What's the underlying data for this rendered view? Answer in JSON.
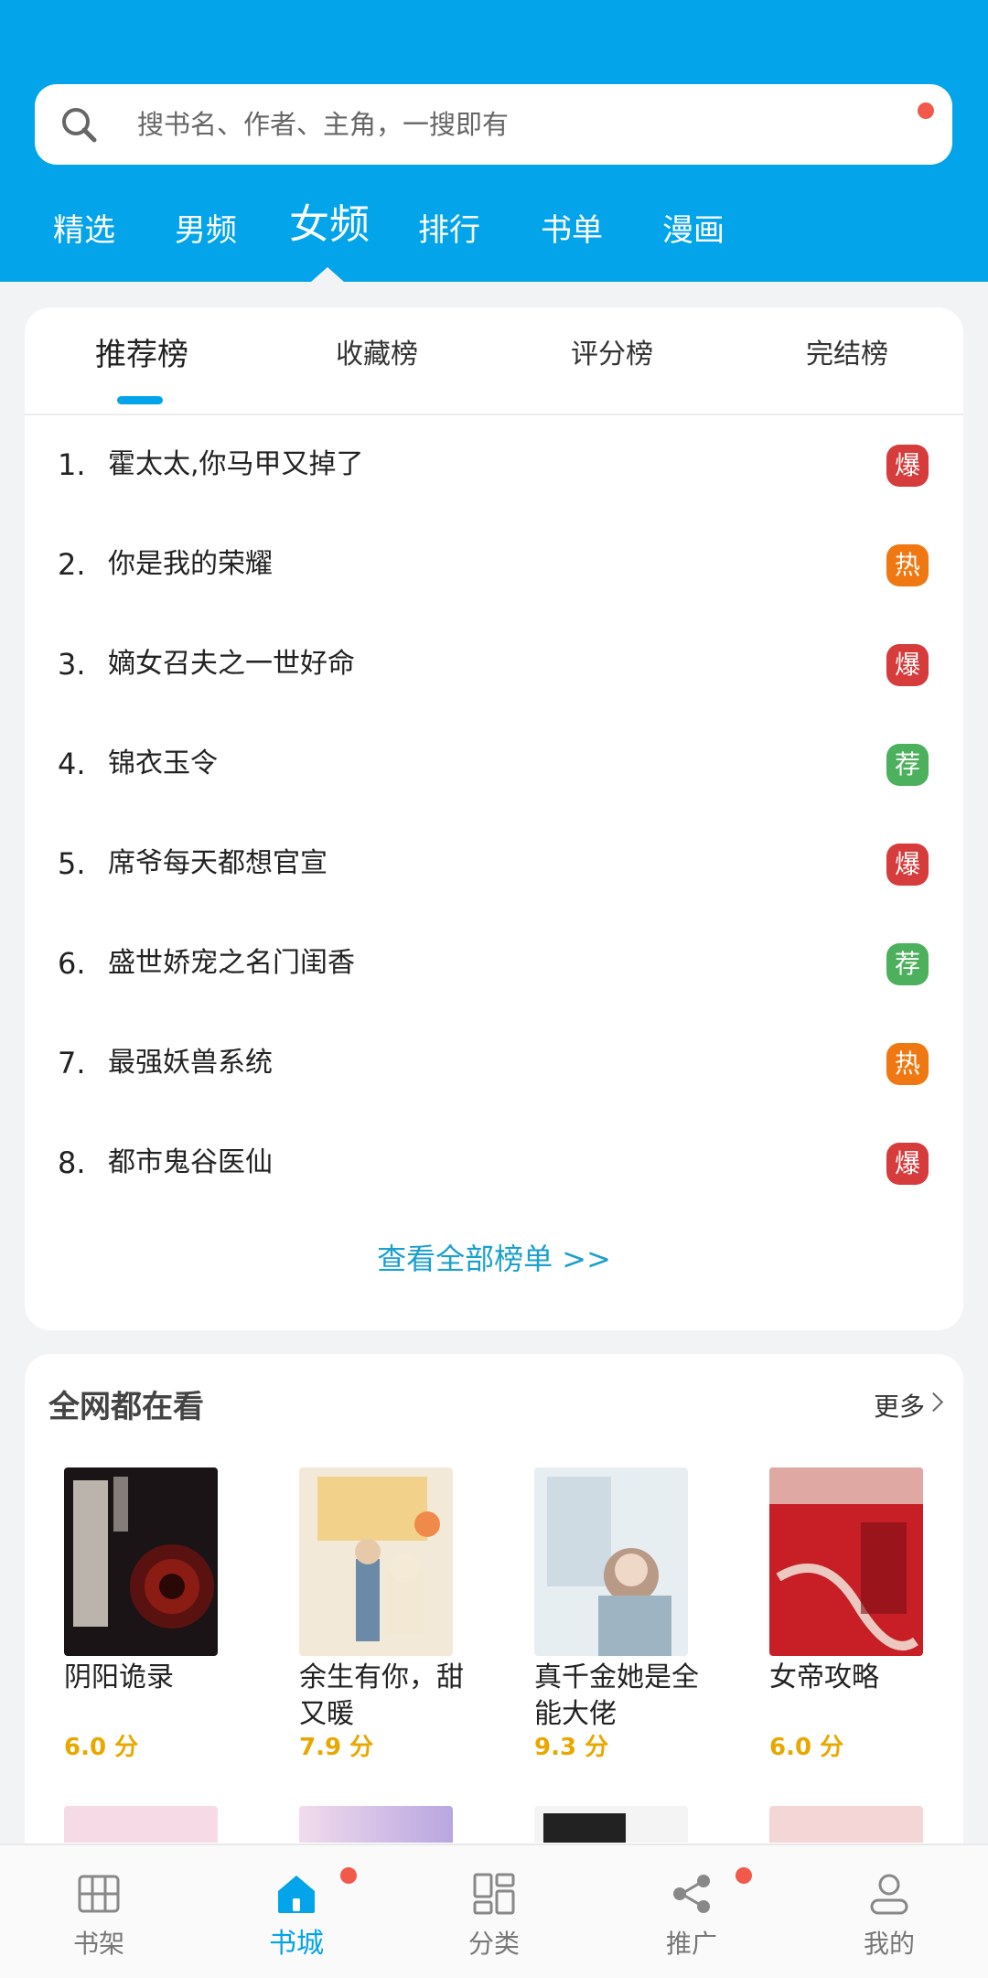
{
  "search": {
    "placeholder": "搜书名、作者、主角，一搜即有"
  },
  "channel_tabs": [
    "精选",
    "男频",
    "女频",
    "排行",
    "书单",
    "漫画"
  ],
  "active_channel": "女频",
  "rank": {
    "tabs": [
      "推荐榜",
      "收藏榜",
      "评分榜",
      "完结榜"
    ],
    "active_tab": "推荐榜",
    "items": [
      {
        "num": "1.",
        "title": "霍太太,你马甲又掉了",
        "badge": "爆",
        "badge_color": "#d63c3c"
      },
      {
        "num": "2.",
        "title": "你是我的荣耀",
        "badge": "热",
        "badge_color": "#f07812"
      },
      {
        "num": "3.",
        "title": "嫡女召夫之一世好命",
        "badge": "爆",
        "badge_color": "#d63c3c"
      },
      {
        "num": "4.",
        "title": "锦衣玉令",
        "badge": "荐",
        "badge_color": "#4cb05c"
      },
      {
        "num": "5.",
        "title": "席爷每天都想官宣",
        "badge": "爆",
        "badge_color": "#d63c3c"
      },
      {
        "num": "6.",
        "title": "盛世娇宠之名门闺香",
        "badge": "荐",
        "badge_color": "#4cb05c"
      },
      {
        "num": "7.",
        "title": "最强妖兽系统",
        "badge": "热",
        "badge_color": "#f07812"
      },
      {
        "num": "8.",
        "title": "都市鬼谷医仙",
        "badge": "爆",
        "badge_color": "#d63c3c"
      }
    ],
    "view_all": "查看全部榜单 >>"
  },
  "popular": {
    "title": "全网都在看",
    "more": "更多",
    "books": [
      {
        "title": "阴阳诡录",
        "score": "6.0 分"
      },
      {
        "title": "余生有你，甜又暖",
        "score": "7.9 分"
      },
      {
        "title": "真千金她是全能大佬",
        "score": "9.3 分"
      },
      {
        "title": "女帝攻略",
        "score": "6.0 分"
      }
    ]
  },
  "nav": [
    {
      "label": "书架",
      "icon": "bookshelf-icon"
    },
    {
      "label": "书城",
      "icon": "home-icon",
      "active": true,
      "dot": true
    },
    {
      "label": "分类",
      "icon": "category-grid-icon"
    },
    {
      "label": "推广",
      "icon": "share-icon",
      "dot": true
    },
    {
      "label": "我的",
      "icon": "user-icon"
    }
  ],
  "colors": {
    "brand": "#03a4ea",
    "score": "#e9a800",
    "link": "#1aa0cc",
    "dot": "#f15a4a"
  }
}
